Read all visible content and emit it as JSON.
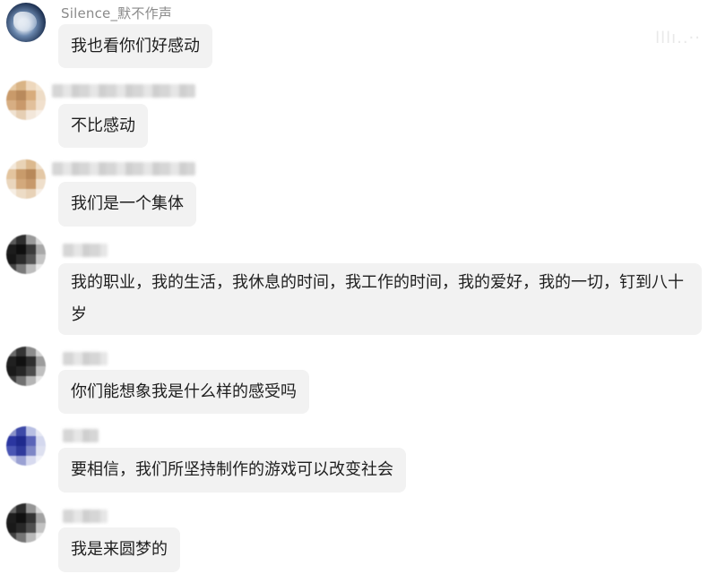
{
  "messages": [
    {
      "sender": "Silence_默不作声",
      "text": "我也看你们好感动"
    },
    {
      "sender": "",
      "text": "不比感动"
    },
    {
      "sender": "",
      "text": "我们是一个集体"
    },
    {
      "sender": "",
      "text": "我的职业，我的生活，我休息的时间，我工作的时间，我的爱好，我的一切，钉到八十岁"
    },
    {
      "sender": "",
      "text": "你们能想象我是什么样的感受吗"
    },
    {
      "sender": "",
      "text": "要相信，我们所坚持制作的游戏可以改变社会"
    },
    {
      "sender": "",
      "text": "我是来圆梦的"
    }
  ],
  "colors": {
    "bubble_bg": "#f2f2f2",
    "sender_text": "#8a8a8a",
    "message_text": "#1e1e1e"
  }
}
